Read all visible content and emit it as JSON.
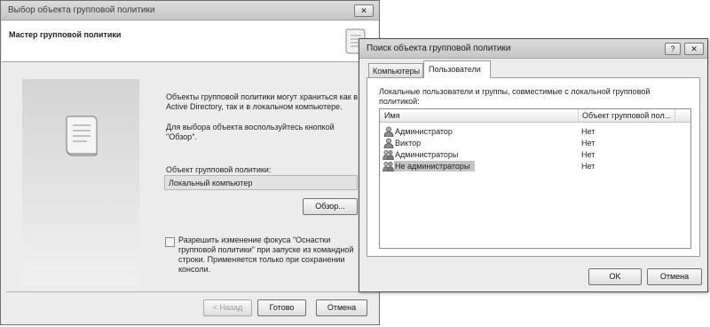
{
  "wizard": {
    "title": "Выбор объекта групповой политики",
    "close_glyph": "✕",
    "header": "Мастер групповой политики",
    "description_1": "Объекты групповой политики могут храниться как в Active Directory, так и в локальном компьютере.",
    "description_2": "Для выбора объекта воспользуйтесь кнопкой \"Обзор\".",
    "gpo_label": "Объект групповой политики:",
    "gpo_value": "Локальный компьютер",
    "browse_button": "Обзор...",
    "checkbox_label": "Разрешить изменение фокуса \"Оснастки групповой политики\" при запуске из командной строки. Применяется только при сохранении консоли.",
    "checkbox_checked": false,
    "back_button": "< Назад",
    "finish_button": "Готово",
    "cancel_button": "Отмена",
    "scroll_icon": "scroll-icon"
  },
  "browse_dialog": {
    "title": "Поиск объекта групповой политики",
    "help_glyph": "?",
    "close_glyph": "✕",
    "tabs": [
      {
        "label": "Компьютеры",
        "active": false
      },
      {
        "label": "Пользователи",
        "active": true
      }
    ],
    "description": "Локальные пользователи и группы, совместимые с локальной групповой политикой:",
    "columns": [
      "Имя",
      "Объект групповой пол..."
    ],
    "rows": [
      {
        "name": "Администратор",
        "gpo": "Нет",
        "icon": "user-icon",
        "selected": false
      },
      {
        "name": "Виктор",
        "gpo": "Нет",
        "icon": "user-icon",
        "selected": false
      },
      {
        "name": "Администраторы",
        "gpo": "Нет",
        "icon": "group-icon",
        "selected": false
      },
      {
        "name": "Не администраторы",
        "gpo": "Нет",
        "icon": "group-icon",
        "selected": true
      }
    ],
    "ok_button": "OK",
    "cancel_button": "Отмена"
  }
}
